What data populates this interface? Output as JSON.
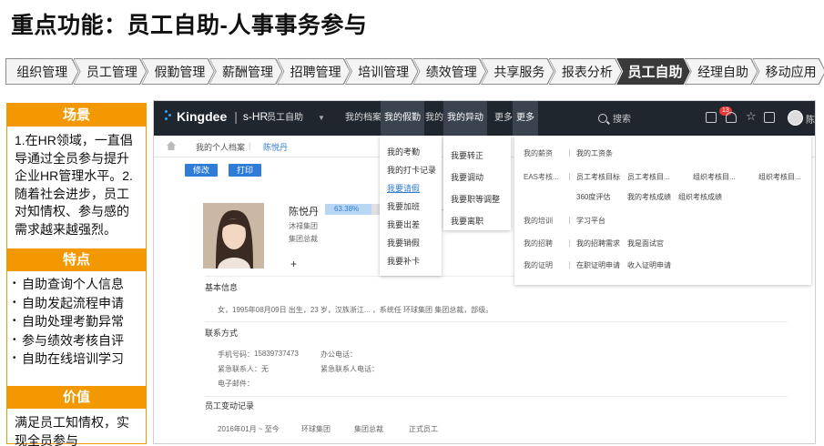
{
  "title": "重点功能：员工自助-人事事务参与",
  "nav": [
    {
      "label": "组织管理"
    },
    {
      "label": "员工管理"
    },
    {
      "label": "假勤管理"
    },
    {
      "label": "薪酬管理"
    },
    {
      "label": "招聘管理"
    },
    {
      "label": "培训管理"
    },
    {
      "label": "绩效管理"
    },
    {
      "label": "共享服务"
    },
    {
      "label": "报表分析"
    },
    {
      "label": "员工自助",
      "active": true
    },
    {
      "label": "经理自助"
    },
    {
      "label": "移动应用"
    }
  ],
  "left": {
    "scene_title": "场景",
    "scene_text": "1.在HR领域，一直倡导通过全员参与提升企业HR管理水平。2.随着社会进步，员工对知情权、参与感的需求越来越强烈。",
    "feature_title": "特点",
    "features": [
      "自助查询个人信息",
      "自助发起流程申请",
      "自助处理考勤异常",
      "参与绩效考核自评",
      "自助在线培训学习"
    ],
    "value_title": "价值",
    "value_text": "满足员工知情权，实现全员参与"
  },
  "app": {
    "logo": "Kingdee",
    "product": "s-HR",
    "menu": [
      "员工自助",
      "我的档案",
      "我的假勤",
      "我的...",
      "我的异动",
      "更多"
    ],
    "search_placeholder": "搜索",
    "notif_count": "13",
    "user": "陈悦",
    "breadcrumb": [
      "我的个人档案",
      "陈悦丹"
    ],
    "buttons": {
      "edit": "修改",
      "print": "打印"
    },
    "profile": {
      "name": "陈悦丹",
      "completion": "63.38%",
      "company": "沐禄集团",
      "dept": "集团总裁",
      "section_basic": "基本信息",
      "basic_text": "女，1995年08月09日 出生，23 岁，汉族浙江... ，系统任 环球集团 集团总裁，部级。",
      "section_contact": "联系方式",
      "mobile_label": "手机号码：",
      "mobile": "15839737473",
      "office_label": "办公电话：",
      "emergency_label": "紧急联系人：",
      "emergency": "无",
      "emergency_phone_label": "紧急联系人电话：",
      "email_label": "电子邮件：",
      "section_change": "员工变动记录",
      "change_row": [
        "2016年01月 ~ 至今",
        "环球集团",
        "集团总裁",
        "正式员工"
      ]
    },
    "dd_attendance": [
      "我的考勤",
      "我的打卡记录",
      "我要请假",
      "我要加班",
      "我要出差",
      "我要销假",
      "我要补卡"
    ],
    "dd_change": [
      "我要转正",
      "我要调动",
      "我要职等调整",
      "我要离职"
    ],
    "dd_more": [
      {
        "head": "我的薪资",
        "items": [
          "我的工资条"
        ]
      },
      {
        "head": "EAS考核...",
        "items": [
          "员工考核目标",
          "员工考核目...",
          "组织考核目...",
          "组织考核目...",
          "领导考核评分"
        ]
      },
      {
        "head": "",
        "items": [
          "360度评估",
          "我的考核成绩",
          "组织考核成绩"
        ]
      },
      {
        "head": "我的培训",
        "items": [
          "学习平台"
        ]
      },
      {
        "head": "我的招聘",
        "items": [
          "我的招聘需求",
          "我是面试官"
        ]
      },
      {
        "head": "我的证明",
        "items": [
          "在职证明申请",
          "收入证明申请"
        ]
      }
    ]
  }
}
